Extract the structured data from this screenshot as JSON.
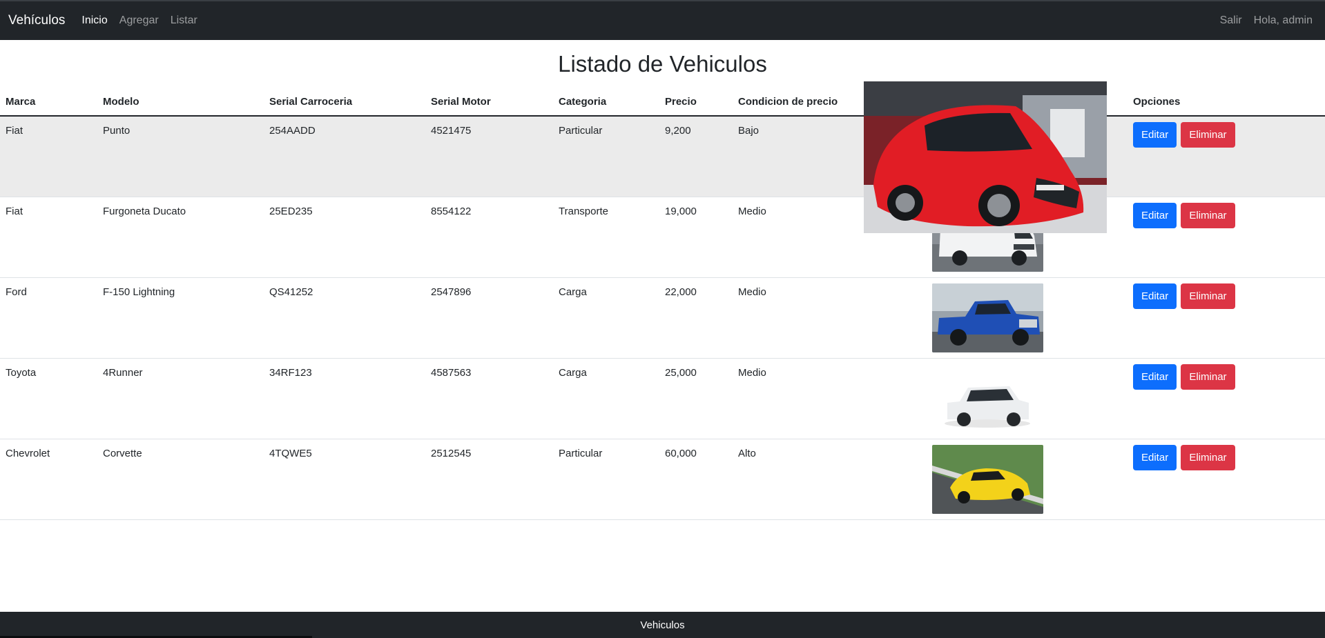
{
  "navbar": {
    "brand": "Vehículos",
    "links": [
      "Inicio",
      "Agregar",
      "Listar"
    ],
    "logout": "Salir",
    "greeting": "Hola, admin"
  },
  "page": {
    "title": "Listado de Vehiculos"
  },
  "table": {
    "headers": [
      "Marca",
      "Modelo",
      "Serial Carroceria",
      "Serial Motor",
      "Categoria",
      "Precio",
      "Condicion de precio",
      "",
      "Opciones"
    ],
    "rows": [
      {
        "marca": "Fiat",
        "modelo": "Punto",
        "carroceria": "254AADD",
        "motor": "4521475",
        "categoria": "Particular",
        "precio": "9,200",
        "condicion": "Bajo",
        "image": "red-hatchback-car-photo"
      },
      {
        "marca": "Fiat",
        "modelo": "Furgoneta Ducato",
        "carroceria": "25ED235",
        "motor": "8554122",
        "categoria": "Transporte",
        "precio": "19,000",
        "condicion": "Medio",
        "image": "white-van-photo"
      },
      {
        "marca": "Ford",
        "modelo": "F-150 Lightning",
        "carroceria": "QS41252",
        "motor": "2547896",
        "categoria": "Carga",
        "precio": "22,000",
        "condicion": "Medio",
        "image": "blue-pickup-truck-photo"
      },
      {
        "marca": "Toyota",
        "modelo": "4Runner",
        "carroceria": "34RF123",
        "motor": "4587563",
        "categoria": "Carga",
        "precio": "25,000",
        "condicion": "Medio",
        "image": "white-suv-photo"
      },
      {
        "marca": "Chevrolet",
        "modelo": "Corvette",
        "carroceria": "4TQWE5",
        "motor": "2512545",
        "categoria": "Particular",
        "precio": "60,000",
        "condicion": "Alto",
        "image": "yellow-sports-car-photo"
      }
    ],
    "edit_label": "Editar",
    "delete_label": "Eliminar"
  },
  "footer": {
    "text": "Vehiculos"
  },
  "colors": {
    "navbar": "#212529",
    "primary": "#0d6efd",
    "danger": "#dc3545",
    "row_highlight": "#ebebeb"
  }
}
